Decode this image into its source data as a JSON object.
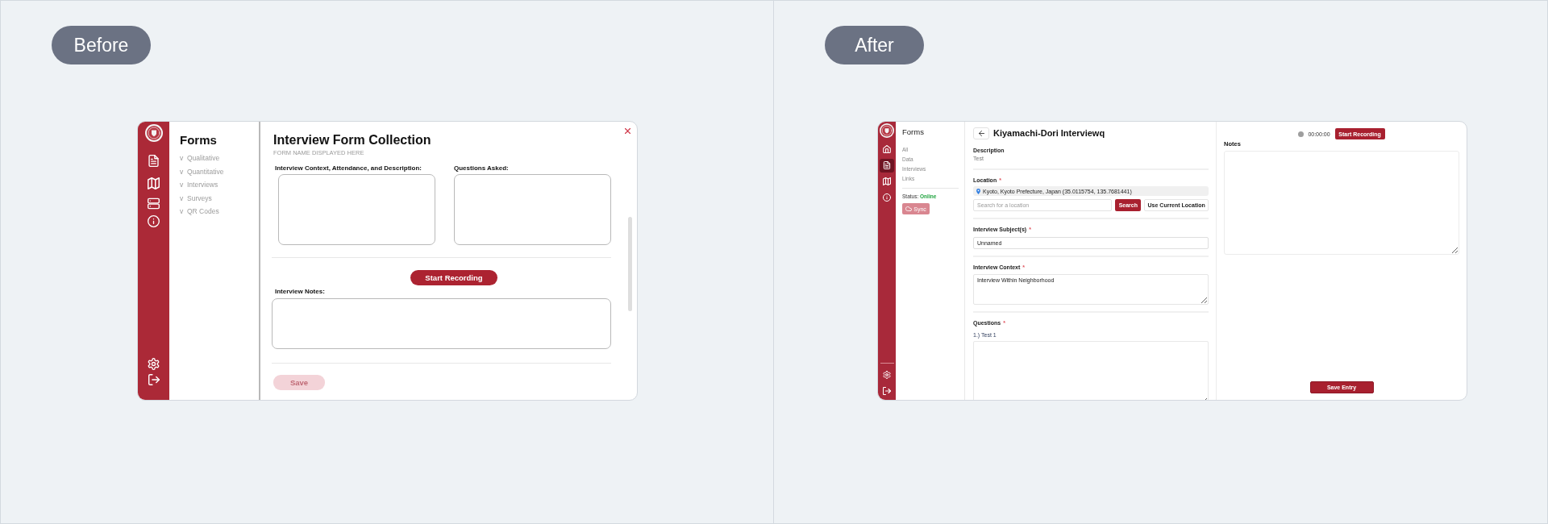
{
  "before": {
    "badge": "Before",
    "sidebar": {
      "title": "Forms",
      "items": [
        {
          "caret": "v",
          "label": "Qualitative"
        },
        {
          "caret": "v",
          "label": "Quantitative"
        },
        {
          "caret": "v",
          "label": "Interviews"
        },
        {
          "caret": "v",
          "label": "Surveys"
        },
        {
          "caret": "v",
          "label": "QR Codes"
        }
      ]
    },
    "form": {
      "title": "Interview Form Collection",
      "subtitle": "FORM NAME DISPLAYED HERE",
      "fields": [
        {
          "label": "Interview Context, Attendance, and Description:"
        },
        {
          "label": "Questions Asked:"
        }
      ],
      "record_button": "Start Recording",
      "notes_label": "Interview Notes:",
      "save_button": {
        "label": "Save",
        "disabled": true
      }
    }
  },
  "after": {
    "badge": "After",
    "rail": [
      {
        "selected": false
      },
      {
        "selected": true
      },
      {
        "selected": false
      },
      {
        "selected": false
      }
    ],
    "sidebar": {
      "title": "Forms",
      "items": [
        "All",
        "Data",
        "Interviews",
        "Links"
      ],
      "status": {
        "label": "Status:",
        "value": "Online"
      },
      "sync_button": {
        "label": "Sync",
        "disabled": true
      }
    },
    "form": {
      "title": "Kiyamachi-Dori Interviewq",
      "sections": [
        {
          "kind": "text",
          "label": "Description",
          "value": "Test"
        },
        {
          "kind": "location",
          "label": "Location",
          "required_mark": "*",
          "location": "Kyoto, Kyoto Prefecture, Japan (35.0115754, 135.7681441)",
          "search": {
            "placeholder": "Search for a location"
          },
          "search_button": "Search",
          "current_location_button": "Use Current Location"
        },
        {
          "kind": "input",
          "label": "Interview Subject(s)",
          "required_mark": "*",
          "value": "Unnamed"
        },
        {
          "kind": "textarea",
          "label": "Interview Context",
          "required_mark": "*",
          "value": "Interview Within Neighborhood"
        },
        {
          "kind": "questions",
          "label": "Questions",
          "required_mark": "*",
          "question": "1.) Test 1"
        }
      ]
    },
    "recorder": {
      "recording": false,
      "time": "00:00:00",
      "button": "Start Recording"
    },
    "notes": {
      "label": "Notes"
    },
    "save_button": "Save Entry"
  }
}
